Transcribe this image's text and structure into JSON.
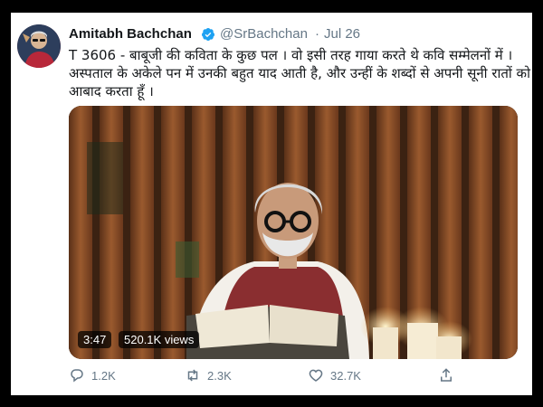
{
  "tweet": {
    "author_name": "Amitabh Bachchan",
    "handle": "@SrBachchan",
    "separator": "·",
    "date": "Jul 26",
    "text_lines": [
      "T 3606 - बाबूजी की कविता के कुछ पल । वो इसी तरह गाया करते थे कवि सम्मेलनों में ।",
      "अस्पताल के अकेले पन में उनकी बहुत याद आती है, और उन्हीं के शब्दों से अपनी सूनी रातों को",
      "आबाद करता हूँ ।"
    ]
  },
  "media": {
    "duration": "3:47",
    "views": "520.1K views"
  },
  "actions": {
    "reply_count": "1.2K",
    "retweet_count": "2.3K",
    "like_count": "32.7K"
  },
  "colors": {
    "background": "#000000",
    "card": "#ffffff",
    "text": "#14171a",
    "muted": "#657786",
    "verified": "#1da1f2"
  },
  "icons": [
    "verified-badge-icon",
    "reply-icon",
    "retweet-icon",
    "like-icon",
    "share-icon"
  ]
}
